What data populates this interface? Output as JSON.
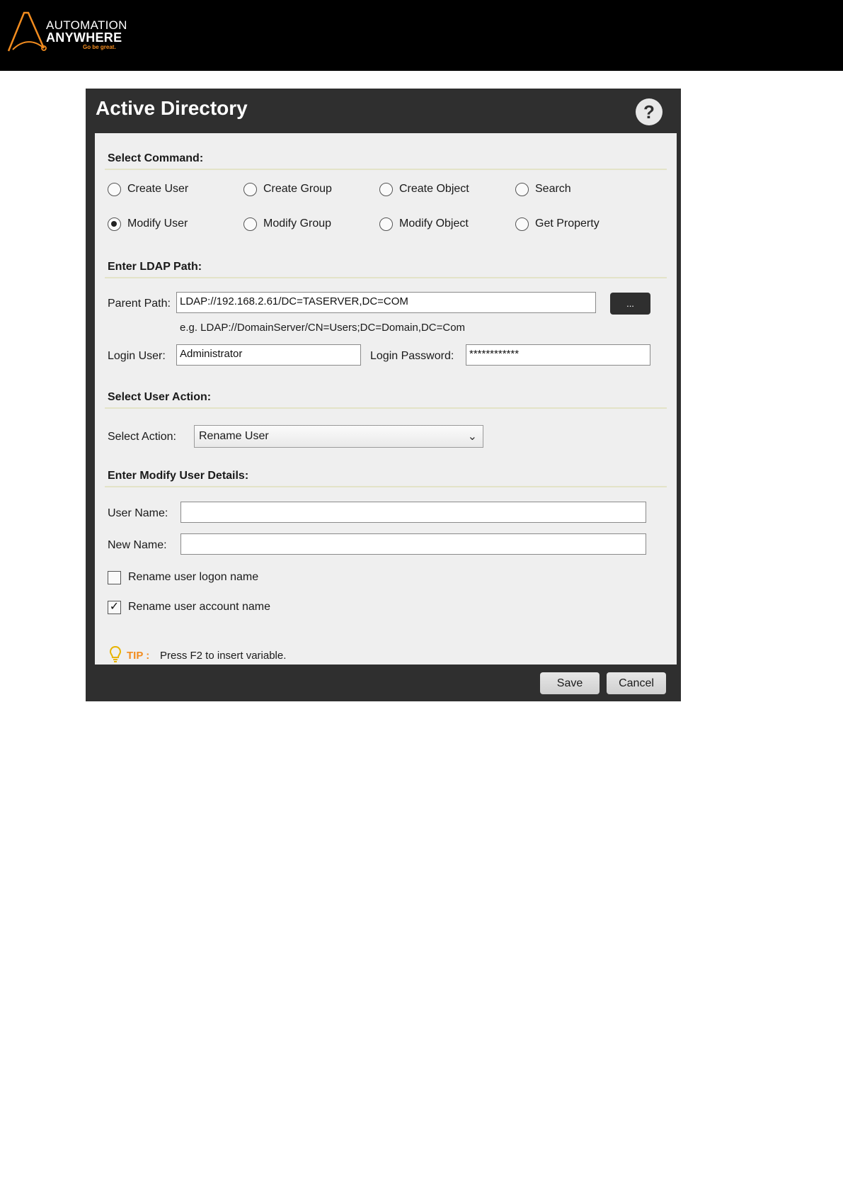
{
  "header": {
    "logo_line1": "AUTOMATION",
    "logo_line2": "ANYWHERE",
    "tagline": "Go be great.",
    "accent_color": "#f28c1f"
  },
  "dialog": {
    "title": "Active Directory",
    "help_label": "?",
    "help_icon": "question-mark-icon"
  },
  "select_command": {
    "title": "Select Command:",
    "options": [
      {
        "label": "Create User",
        "checked": false
      },
      {
        "label": "Create Group",
        "checked": false
      },
      {
        "label": "Create Object",
        "checked": false
      },
      {
        "label": "Search",
        "checked": false
      },
      {
        "label": "Modify User",
        "checked": true
      },
      {
        "label": "Modify Group",
        "checked": false
      },
      {
        "label": "Modify Object",
        "checked": false
      },
      {
        "label": "Get Property",
        "checked": false
      }
    ]
  },
  "ldap": {
    "title": "Enter LDAP Path:",
    "parent_path_label": "Parent Path:",
    "parent_path_value": "LDAP://192.168.2.61/DC=TASERVER,DC=COM",
    "browse_label": "...",
    "example": "e.g. LDAP://DomainServer/CN=Users;DC=Domain,DC=Com",
    "login_user_label": "Login User:",
    "login_user_value": "Administrator",
    "login_password_label": "Login Password:",
    "login_password_value": "************"
  },
  "user_action": {
    "title": "Select User Action:",
    "select_label": "Select Action:",
    "selected": "Rename User"
  },
  "modify_details": {
    "title": "Enter Modify User Details:",
    "user_name_label": "User Name:",
    "user_name_value": "",
    "new_name_label": "New Name:",
    "new_name_value": "",
    "rename_logon_label": "Rename user logon name",
    "rename_logon_checked": false,
    "rename_account_label": "Rename user account name",
    "rename_account_checked": true
  },
  "tip": {
    "label": "TIP :",
    "text": "Press F2 to insert variable.",
    "icon": "lightbulb-icon"
  },
  "footer": {
    "save_label": "Save",
    "cancel_label": "Cancel"
  }
}
